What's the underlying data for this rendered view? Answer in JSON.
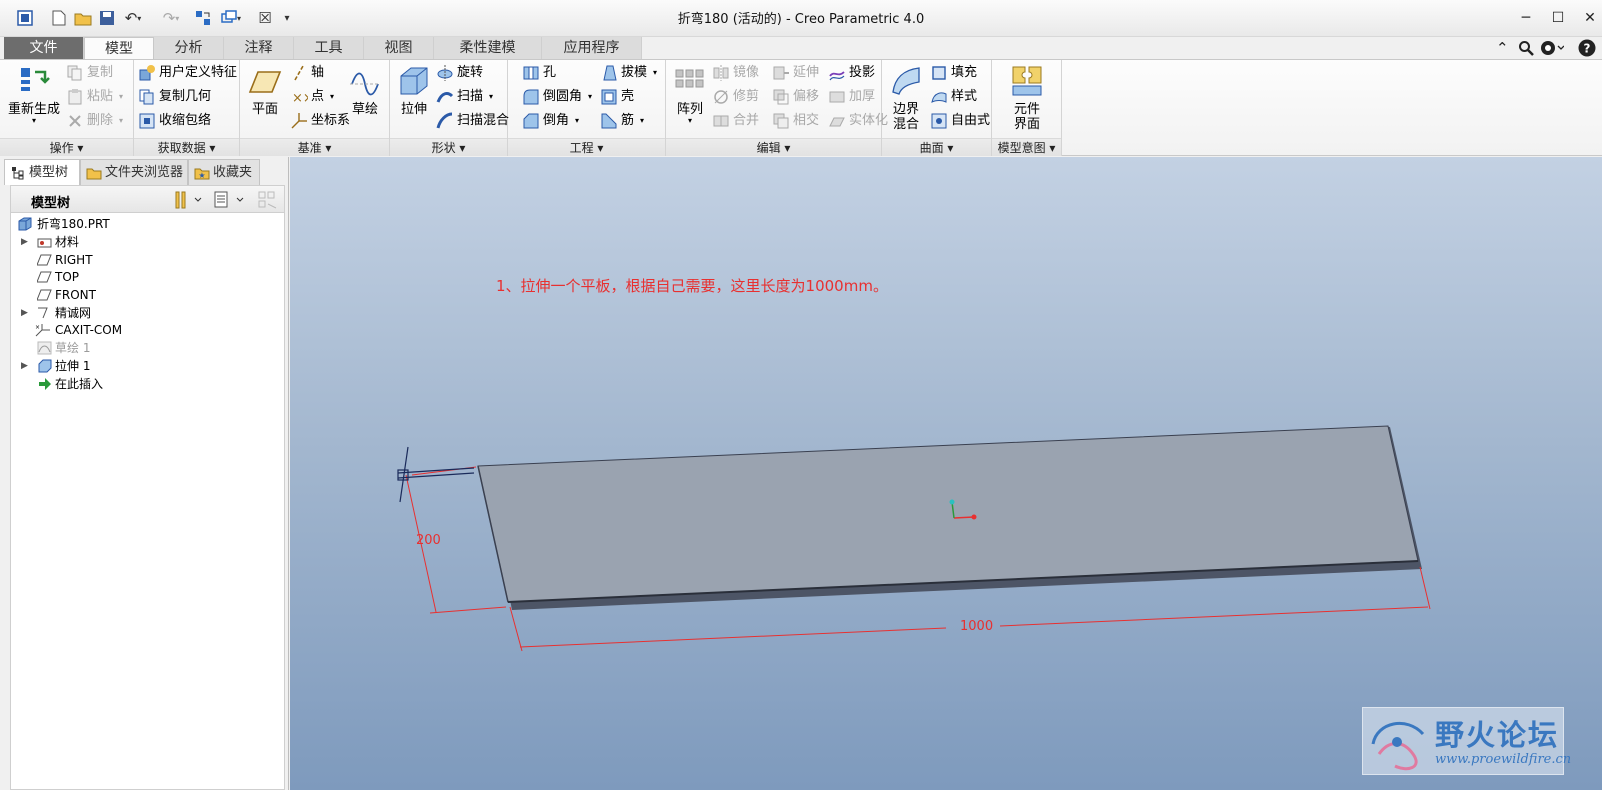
{
  "window": {
    "title": "折弯180 (活动的) - Creo Parametric 4.0"
  },
  "tabs": [
    {
      "label": "文件",
      "kind": "file"
    },
    {
      "label": "模型",
      "kind": "active"
    },
    {
      "label": "分析"
    },
    {
      "label": "注释"
    },
    {
      "label": "工具"
    },
    {
      "label": "视图"
    },
    {
      "label": "柔性建模"
    },
    {
      "label": "应用程序"
    }
  ],
  "ribbon": {
    "operations": {
      "label": "操作",
      "regenerate": "重新生成",
      "copy": "复制",
      "paste": "粘贴",
      "delete": "删除"
    },
    "get_data": {
      "label": "获取数据",
      "udf": "用户定义特征",
      "copy_geom": "复制几何",
      "shrinkwrap": "收缩包络"
    },
    "datum": {
      "label": "基准",
      "plane": "平面",
      "axis": "轴",
      "point": "点",
      "csys": "坐标系",
      "sketch": "草绘"
    },
    "shapes": {
      "label": "形状",
      "extrude": "拉伸",
      "revolve": "旋转",
      "sweep": "扫描",
      "swept_blend": "扫描混合"
    },
    "engineering": {
      "label": "工程",
      "hole": "孔",
      "round": "倒圆角",
      "chamfer": "倒角",
      "draft": "拔模",
      "shell": "壳",
      "rib": "筋"
    },
    "editing": {
      "label": "编辑",
      "pattern": "阵列",
      "mirror": "镜像",
      "trim": "修剪",
      "merge": "合并",
      "extend": "延伸",
      "offset": "偏移",
      "intersect": "相交",
      "project": "投影",
      "thicken": "加厚",
      "solidify": "实体化"
    },
    "surfaces": {
      "label": "曲面",
      "boundary_blend": "边界混合",
      "fill": "填充",
      "style": "样式",
      "freestyle": "自由式"
    },
    "model_intent": {
      "label": "模型意图",
      "component_interface": "元件界面"
    }
  },
  "panel": {
    "tabs": [
      "模型树",
      "文件夹浏览器",
      "收藏夹"
    ],
    "header": "模型树",
    "tree": [
      {
        "label": "折弯180.PRT",
        "expandable": false
      },
      {
        "label": "材料",
        "expandable": true
      },
      {
        "label": "RIGHT",
        "expandable": false
      },
      {
        "label": "TOP",
        "expandable": false
      },
      {
        "label": "FRONT",
        "expandable": false
      },
      {
        "label": "精诚网",
        "expandable": true
      },
      {
        "label": "CAXIT-COM",
        "expandable": false
      },
      {
        "label": "草绘 1",
        "expandable": false,
        "dim": true
      },
      {
        "label": "拉伸 1",
        "expandable": true
      },
      {
        "label": "在此插入",
        "expandable": false
      }
    ]
  },
  "viewport": {
    "annotation": "1、拉伸一个平板，根据自己需要，这里长度为1000mm。",
    "dim_width": "200",
    "dim_length": "1000",
    "accent": "#e83030"
  },
  "watermark": {
    "name": "野火论坛",
    "url": "www.proewildfire.cn"
  },
  "colors": {
    "tab_file": "#6d6d6d",
    "plate_top": "#9aa3b0",
    "annotation": "#e83030"
  }
}
